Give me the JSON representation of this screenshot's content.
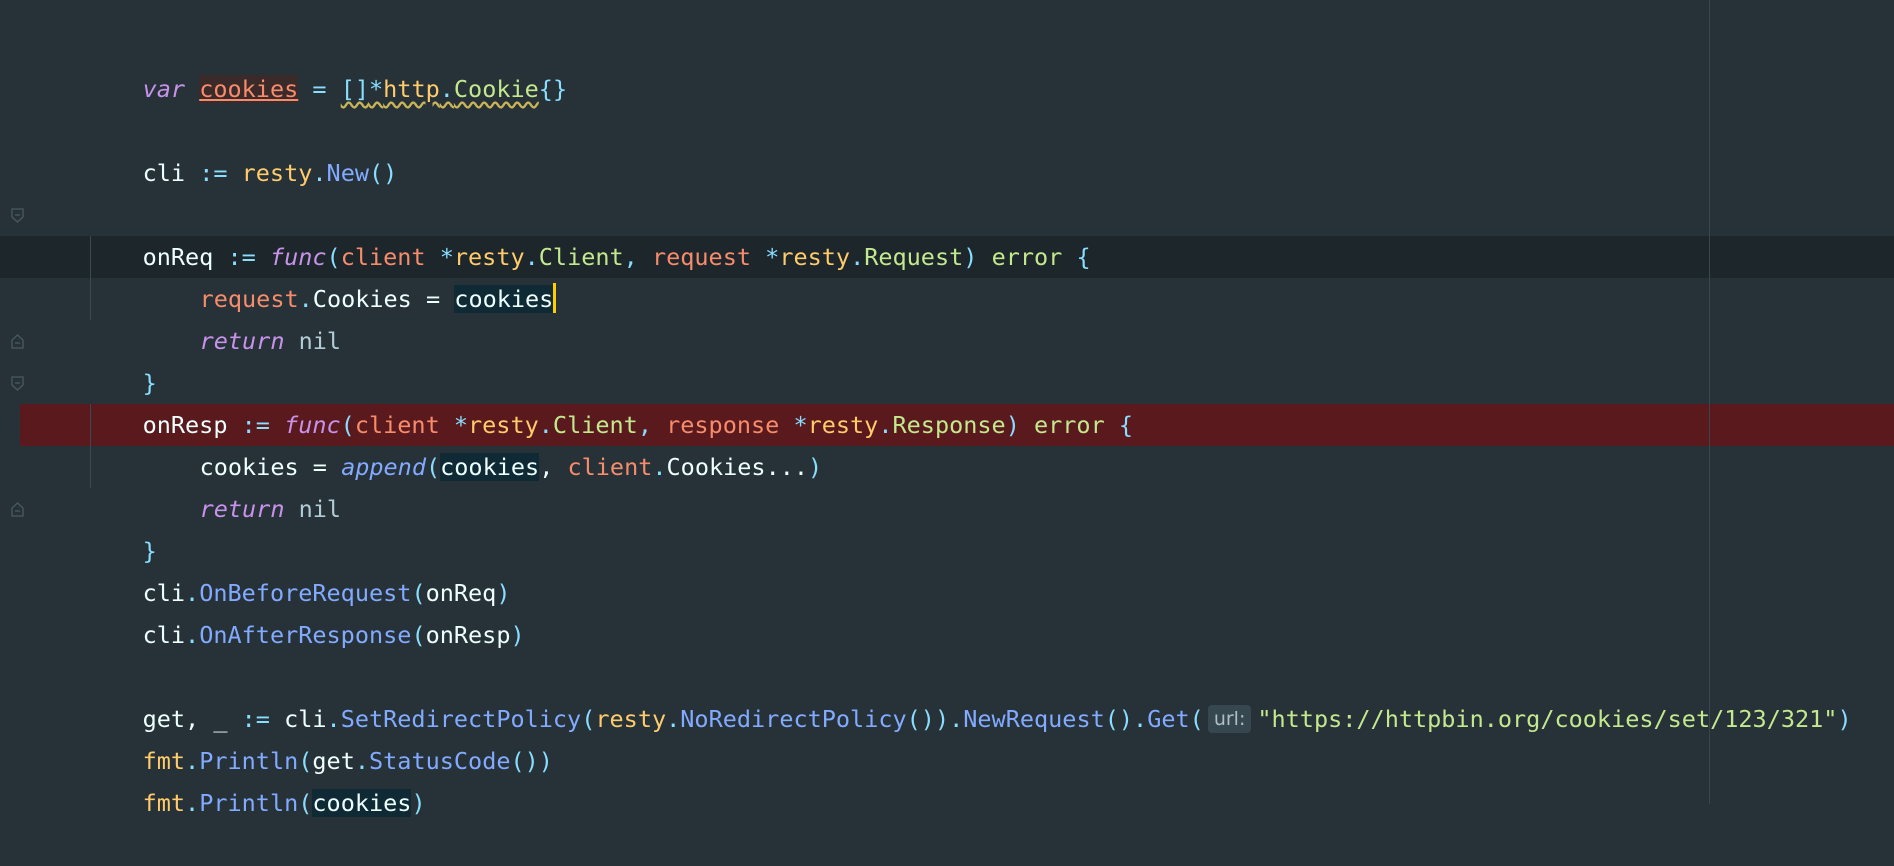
{
  "editor": {
    "line_var": {
      "kw": "var",
      "name": "cookies",
      "eq": " = ",
      "brackets": "[]",
      "star": "*",
      "pkg": "http",
      "dot": ".",
      "type": "Cookie",
      "braces": "{}"
    },
    "line_cli": {
      "name": "cli",
      "op": " := ",
      "pkg": "resty",
      "dot": ".",
      "fn": "New",
      "parens": "()"
    },
    "line_onreq": {
      "name": "onReq",
      "op": " := ",
      "kw": "func",
      "lp": "(",
      "p1": "client",
      "star1": " *",
      "pkg1": "resty",
      "dot1": ".",
      "t1": "Client",
      "comma": ", ",
      "p2": "request",
      "star2": " *",
      "pkg2": "resty",
      "dot2": ".",
      "t2": "Request",
      "rp": ")",
      "ret": " error",
      "brace": " {"
    },
    "line_req_assign": {
      "var": "request",
      "dot": ".",
      "field": "Cookies",
      "eq": " = ",
      "val": "cookies"
    },
    "line_return1": {
      "kw": "return",
      "val": " nil"
    },
    "line_close1": {
      "brace": "}"
    },
    "line_onresp": {
      "name": "onResp",
      "op": " := ",
      "kw": "func",
      "lp": "(",
      "p1": "client",
      "star1": " *",
      "pkg1": "resty",
      "dot1": ".",
      "t1": "Client",
      "comma": ", ",
      "p2": "response",
      "star2": " *",
      "pkg2": "resty",
      "dot2": ".",
      "t2": "Response",
      "rp": ")",
      "ret": " error",
      "brace": " {"
    },
    "line_append": {
      "name": "cookies",
      "eq": " = ",
      "fn": "append",
      "lp": "(",
      "a1": "cookies",
      "comma": ", ",
      "a2": "client",
      "dot": ".",
      "field": "Cookies",
      "ellipsis": "...",
      "rp": ")"
    },
    "line_return2": {
      "kw": "return",
      "val": " nil"
    },
    "line_close2": {
      "brace": "}"
    },
    "line_onbefore": {
      "obj": "cli",
      "dot": ".",
      "fn": "OnBeforeRequest",
      "lp": "(",
      "arg": "onReq",
      "rp": ")"
    },
    "line_onafter": {
      "obj": "cli",
      "dot": ".",
      "fn": "OnAfterResponse",
      "lp": "(",
      "arg": "onResp",
      "rp": ")"
    },
    "line_get": {
      "lhs": "get, _",
      "op": " := ",
      "obj": "cli",
      "dot1": ".",
      "fn1": "SetRedirectPolicy",
      "lp1": "(",
      "pkg": "resty",
      "dot2": ".",
      "fn2": "NoRedirectPolicy",
      "call": "())",
      "dot3": ".",
      "fn3": "NewRequest",
      "call2": "()",
      "dot4": ".",
      "fn4": "Get",
      "lp2": "(",
      "hint": "url:",
      "url": "\"https://httpbin.org/cookies/set/123/321\"",
      "rp": ")"
    },
    "line_print1": {
      "pkg": "fmt",
      "dot": ".",
      "fn": "Println",
      "lp": "(",
      "obj": "get",
      "dot2": ".",
      "fn2": "StatusCode",
      "call": "()",
      "rp": ")"
    },
    "line_print2": {
      "pkg": "fmt",
      "dot": ".",
      "fn": "Println",
      "lp": "(",
      "arg": "cookies",
      "rp": ")"
    }
  },
  "colors": {
    "background": "#263238",
    "error_line": "#5A1A1D",
    "caret": "#FFCC00",
    "keyword": "#C792EA",
    "function": "#82AAFF",
    "package": "#FFCB6B",
    "string": "#C3E88D"
  },
  "icons": {
    "fold_open": "fold-open-icon",
    "fold_close": "fold-close-icon"
  }
}
